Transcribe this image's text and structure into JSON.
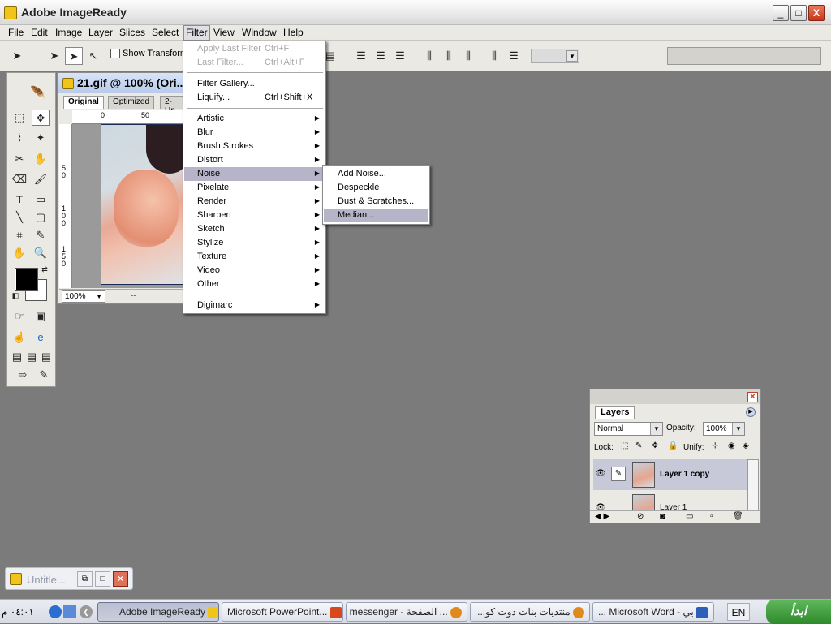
{
  "window": {
    "title": "Adobe ImageReady",
    "min_label": "_",
    "max_label": "□",
    "close_label": "X"
  },
  "menubar": {
    "items": [
      "File",
      "Edit",
      "Image",
      "Layer",
      "Slices",
      "Select",
      "Filter",
      "View",
      "Window",
      "Help"
    ]
  },
  "options": {
    "show_transform": "Show Transform"
  },
  "document": {
    "title": "21.gif @ 100% (Ori...",
    "tabs": [
      "Original",
      "Optimized",
      "2-Up"
    ],
    "ruler_h": [
      "0",
      "50"
    ],
    "ruler_v": [
      "5\n0",
      "1\n0\n0",
      "1\n5\n0"
    ],
    "zoom": "100%",
    "status": "--"
  },
  "filter_menu": {
    "apply_last": "Apply Last Filter",
    "apply_last_shortcut": "Ctrl+F",
    "last_filter": "Last Filter...",
    "last_filter_shortcut": "Ctrl+Alt+F",
    "gallery": "Filter Gallery...",
    "liquify": "Liquify...",
    "liquify_shortcut": "Ctrl+Shift+X",
    "categories": [
      "Artistic",
      "Blur",
      "Brush Strokes",
      "Distort",
      "Noise",
      "Pixelate",
      "Render",
      "Sharpen",
      "Sketch",
      "Stylize",
      "Texture",
      "Video",
      "Other"
    ],
    "digimarc": "Digimarc"
  },
  "noise_menu": {
    "items": [
      "Add Noise...",
      "Despeckle",
      "Dust & Scratches...",
      "Median..."
    ]
  },
  "layers": {
    "tab": "Layers",
    "blend_mode": "Normal",
    "opacity_label": "Opacity:",
    "opacity_value": "100%",
    "lock_label": "Lock:",
    "unify_label": "Unify:",
    "rows": [
      "Layer 1 copy",
      "Layer 1"
    ]
  },
  "minimized": {
    "title": "Untitle..."
  },
  "taskbar": {
    "start": "ابدأ",
    "lang": "EN",
    "clock": "٠٤:٠١ م",
    "buttons": [
      "Adobe ImageReady",
      "Microsoft PowerPoint...",
      "... الصفحة - messenger",
      "منتديات بنات دوت كو...",
      "... Microsoft Word - بي"
    ]
  },
  "colors": {
    "workspace": "#7b7b7b",
    "menu_highlight": "#b5b4c8",
    "foreground": "#000000",
    "background": "#ffffff"
  }
}
